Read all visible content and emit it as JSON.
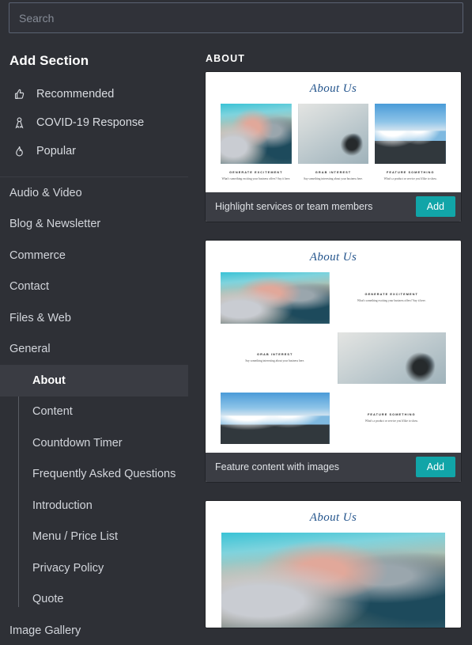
{
  "search": {
    "placeholder": "Search",
    "value": ""
  },
  "sidebar": {
    "title": "Add Section",
    "quick_items": [
      {
        "label": "Recommended",
        "icon": "thumbs-up-icon"
      },
      {
        "label": "COVID-19 Response",
        "icon": "ribbon-icon"
      },
      {
        "label": "Popular",
        "icon": "flame-icon"
      }
    ],
    "categories": [
      {
        "label": "Audio & Video"
      },
      {
        "label": "Blog & Newsletter"
      },
      {
        "label": "Commerce"
      },
      {
        "label": "Contact"
      },
      {
        "label": "Files & Web"
      },
      {
        "label": "General"
      }
    ],
    "general_children": [
      {
        "label": "About",
        "active": true
      },
      {
        "label": "Content",
        "active": false
      },
      {
        "label": "Countdown Timer",
        "active": false
      },
      {
        "label": "Frequently Asked Questions",
        "active": false
      },
      {
        "label": "Introduction",
        "active": false
      },
      {
        "label": "Menu / Price List",
        "active": false
      },
      {
        "label": "Privacy Policy",
        "active": false
      },
      {
        "label": "Quote",
        "active": false
      }
    ],
    "trailing_category": {
      "label": "Image Gallery"
    }
  },
  "content": {
    "header": "ABOUT",
    "add_button_label": "Add",
    "accent_color": "#11a5a8",
    "heading_color": "#23548c",
    "cards": [
      {
        "preview_title": "About Us",
        "layout": "three-columns",
        "columns": [
          {
            "image": "team-meeting-photo",
            "heading": "GENERATE EXCITEMENT",
            "body": "What's something exciting your business offers? Say it here."
          },
          {
            "image": "overhead-group-photo",
            "heading": "GRAB INTEREST",
            "body": "Say something interesting about your business here."
          },
          {
            "image": "city-skyline-photo",
            "heading": "FEATURE SOMETHING",
            "body": "What's a product or service you'd like to show."
          }
        ],
        "footer_label": "Highlight services or team members"
      },
      {
        "preview_title": "About Us",
        "layout": "alternating-rows",
        "rows": [
          {
            "side": "image-left",
            "image": "team-meeting-photo",
            "heading": "GENERATE EXCITEMENT",
            "body": "What's something exciting your business offers? Say it here."
          },
          {
            "side": "image-right",
            "image": "overhead-group-photo",
            "heading": "GRAB INTEREST",
            "body": "Say something interesting about your business here."
          },
          {
            "side": "image-left",
            "image": "city-skyline-photo",
            "heading": "FEATURE SOMETHING",
            "body": "What's a product or service you'd like to show."
          }
        ],
        "footer_label": "Feature content with images"
      },
      {
        "preview_title": "About Us",
        "layout": "single-image",
        "image": "team-meeting-photo",
        "footer_label": ""
      }
    ]
  }
}
